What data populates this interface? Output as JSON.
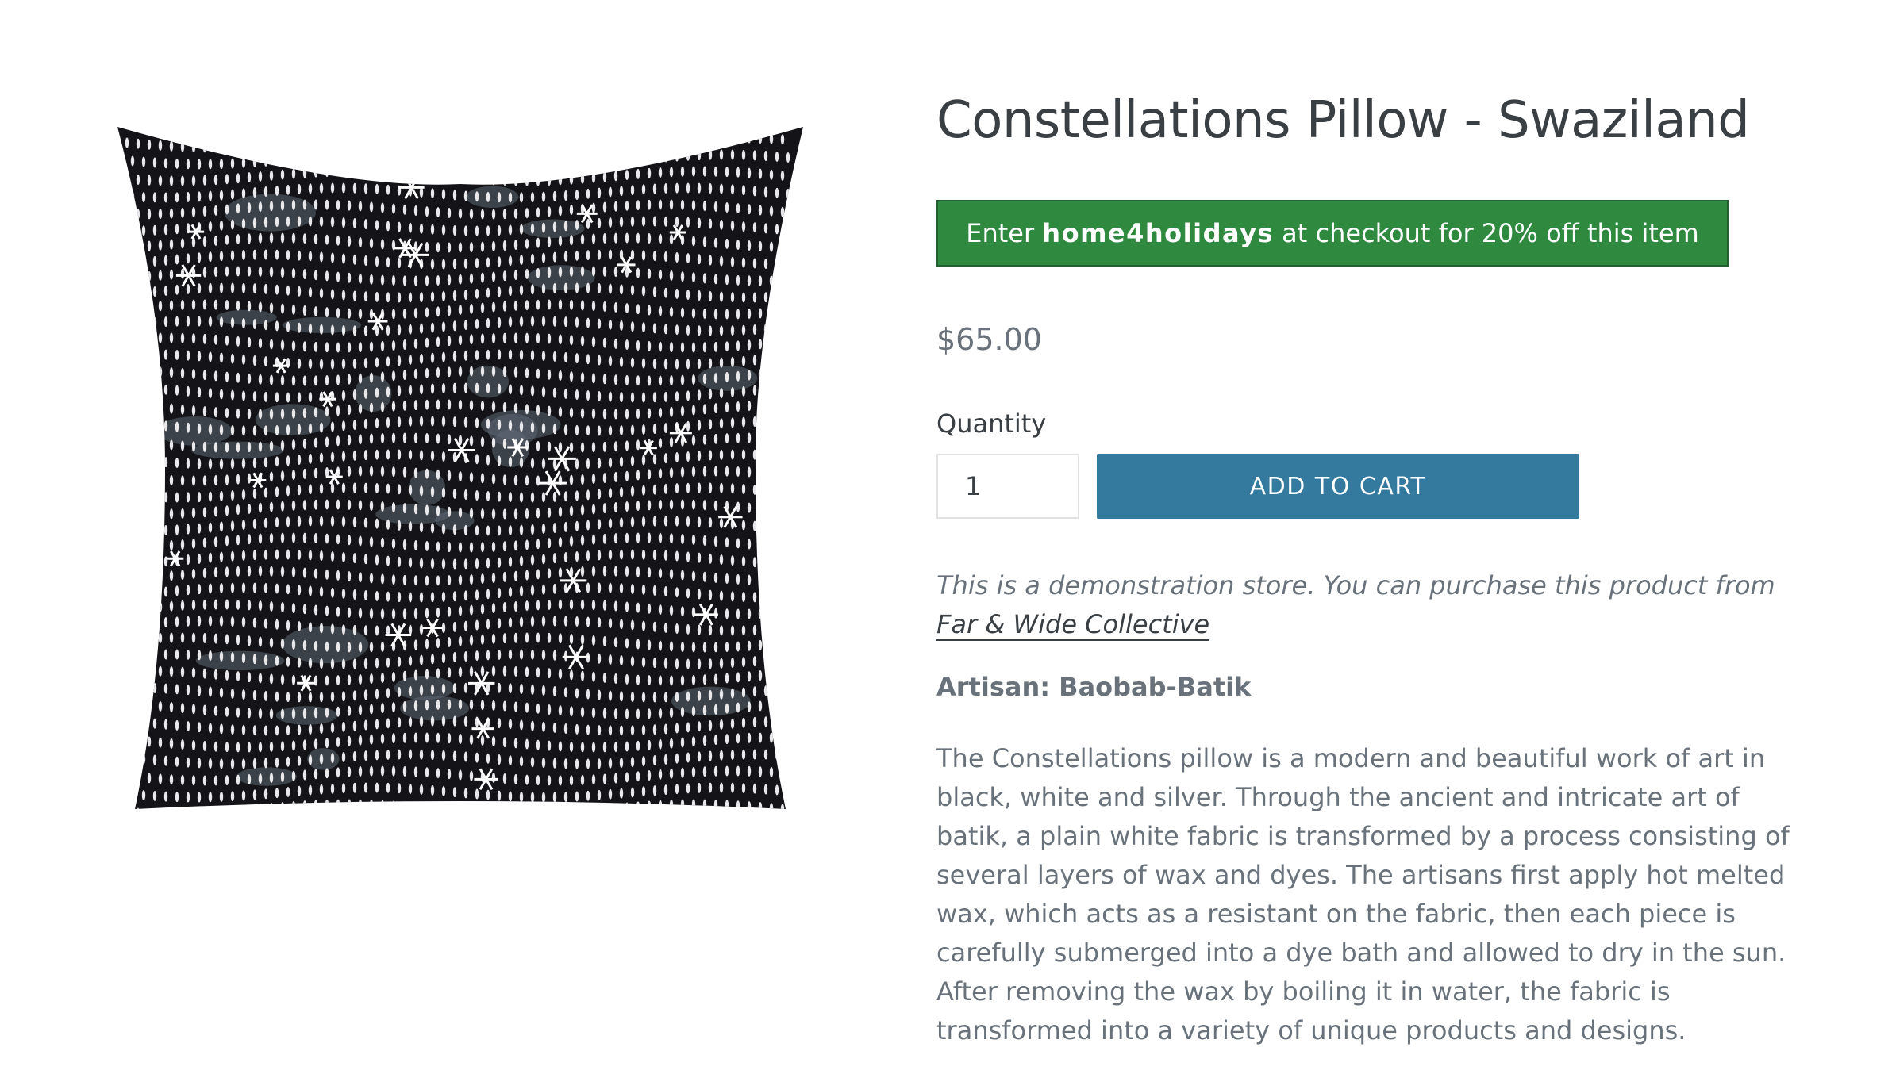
{
  "product": {
    "image_alt": "Constellations pillow",
    "title": "Constellations Pillow - Swaziland",
    "price": "$65.00"
  },
  "promo": {
    "prefix": "Enter",
    "code": "home4holidays",
    "suffix": "at checkout for 20% off this item",
    "background": "#2f8a40"
  },
  "purchase": {
    "quantity_label": "Quantity",
    "quantity_value": "1",
    "add_to_cart_label": "ADD TO CART",
    "button_color": "#34799e"
  },
  "demo_note": {
    "text": "This is a demonstration store. You can purchase this product from",
    "link_text": "Far & Wide Collective"
  },
  "artisan": "Artisan: Baobab-Batik",
  "description": "The Constellations pillow is a modern and beautiful work of art in black, white and silver. Through the ancient and intricate art of batik, a plain white fabric is transformed by a process consisting of several layers of wax and dyes. The artisans first apply hot melted wax, which acts as a resistant on the fabric, then each piece is carefully submerged into a dye bath and allowed to dry in the sun. After removing the wax by boiling it in water, the fabric is transformed into a variety of unique products and designs."
}
